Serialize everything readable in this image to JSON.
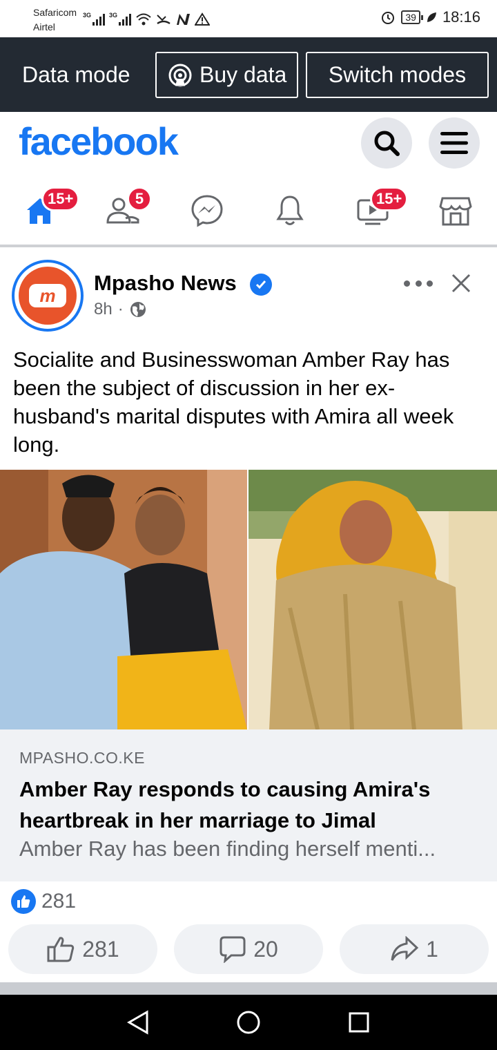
{
  "status_bar": {
    "carrier_1": "Safaricom",
    "carrier_2": "Airtel",
    "network_1": "3G",
    "network_2": "3G",
    "battery": "39",
    "time": "18:16"
  },
  "data_bar": {
    "mode_label": "Data mode",
    "buy_label": "Buy data",
    "switch_label": "Switch modes"
  },
  "header": {
    "logo": "facebook",
    "icons": [
      "search-icon",
      "menu-icon"
    ]
  },
  "nav": {
    "accent": "#1877f2",
    "badge_color": "#e41e3f",
    "items": [
      {
        "name": "home",
        "badge": "15+"
      },
      {
        "name": "friends",
        "badge": "5"
      },
      {
        "name": "messenger",
        "badge": ""
      },
      {
        "name": "notifications",
        "badge": ""
      },
      {
        "name": "watch",
        "badge": "15+"
      },
      {
        "name": "marketplace",
        "badge": ""
      }
    ]
  },
  "post": {
    "page_name": "Mpasho News",
    "time": "8h",
    "separator": "·",
    "text": "Socialite and Businesswoman Amber Ray has been the subject of discussion in her ex-husband's marital disputes with Amira all week long.",
    "link": {
      "domain": "MPASHO.CO.KE",
      "title": "Amber Ray responds to causing Amira's heartbreak in her marriage to Jimal",
      "description": "Amber Ray has been finding herself menti..."
    },
    "reaction_count": "281",
    "actions": {
      "like": "281",
      "comment": "20",
      "share": "1"
    }
  }
}
